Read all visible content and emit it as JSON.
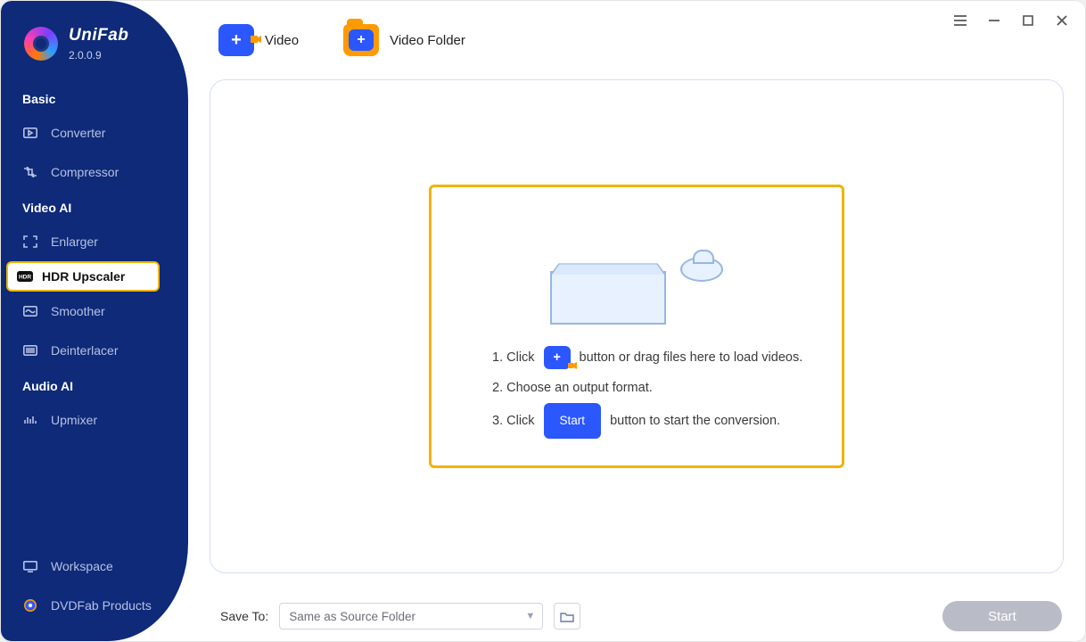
{
  "app": {
    "name": "UniFab",
    "version": "2.0.0.9"
  },
  "sidebar": {
    "sections": [
      {
        "title": "Basic",
        "items": [
          {
            "icon": "play-icon",
            "label": "Converter"
          },
          {
            "icon": "compress-icon",
            "label": "Compressor"
          }
        ]
      },
      {
        "title": "Video AI",
        "items": [
          {
            "icon": "expand-icon",
            "label": "Enlarger"
          },
          {
            "icon": "hdr-icon",
            "label": "HDR Upscaler",
            "active": true
          },
          {
            "icon": "wave-icon",
            "label": "Smoother"
          },
          {
            "icon": "lines-icon",
            "label": "Deinterlacer"
          }
        ]
      },
      {
        "title": "Audio AI",
        "items": [
          {
            "icon": "bars-icon",
            "label": "Upmixer"
          }
        ]
      }
    ],
    "bottom": [
      {
        "icon": "monitor-icon",
        "label": "Workspace"
      },
      {
        "icon": "globe-icon",
        "label": "DVDFab Products"
      }
    ]
  },
  "toolbar": {
    "video_label": "Video",
    "folder_label": "Video Folder"
  },
  "drop": {
    "step1_prefix": "1. Click",
    "step1_suffix": "button or drag files here to load videos.",
    "step2": "2. Choose an output format.",
    "step3_prefix": "3. Click",
    "step3_btn": "Start",
    "step3_suffix": "button to start the conversion."
  },
  "footer": {
    "save_to_label": "Save To:",
    "save_to_value": "Same as Source Folder",
    "start_label": "Start"
  }
}
